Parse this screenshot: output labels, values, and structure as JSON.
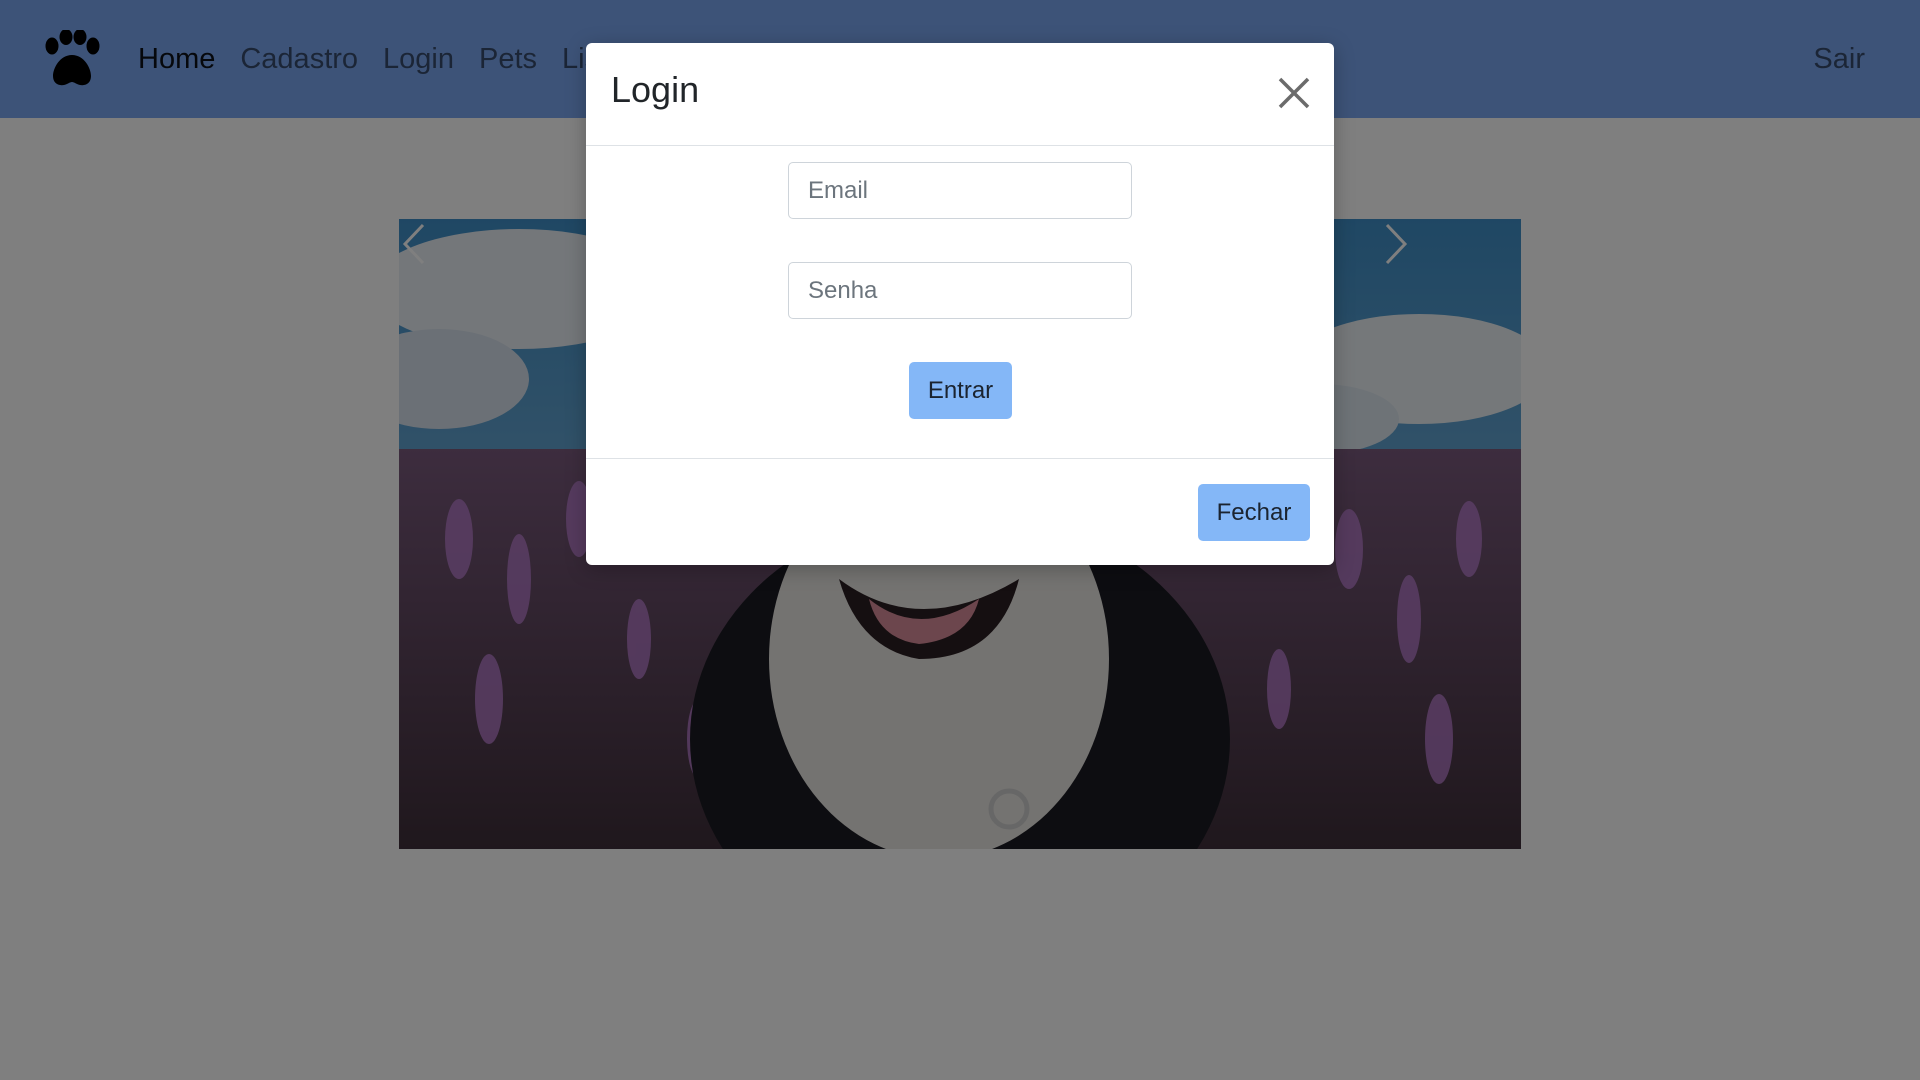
{
  "navbar": {
    "brand_icon": "paw-icon",
    "links": [
      {
        "label": "Home",
        "active": true
      },
      {
        "label": "Cadastro",
        "active": false
      },
      {
        "label": "Login",
        "active": false
      },
      {
        "label": "Pets",
        "active": false
      },
      {
        "label": "Lis",
        "active": false
      }
    ],
    "right_link": "Sair"
  },
  "carousel": {
    "prev_icon": "chevron-left-icon",
    "next_icon": "chevron-right-icon",
    "image": "dog-in-lavender-field-photo"
  },
  "modal": {
    "title": "Login",
    "close_icon": "close-icon",
    "email_placeholder": "Email",
    "email_value": "",
    "senha_placeholder": "Senha",
    "senha_value": "",
    "submit_label": "Entrar",
    "close_label": "Fechar"
  },
  "colors": {
    "navbar": "#7ba7f0",
    "button": "#84b7f7",
    "backdrop": "rgba(0,0,0,0.5)"
  }
}
